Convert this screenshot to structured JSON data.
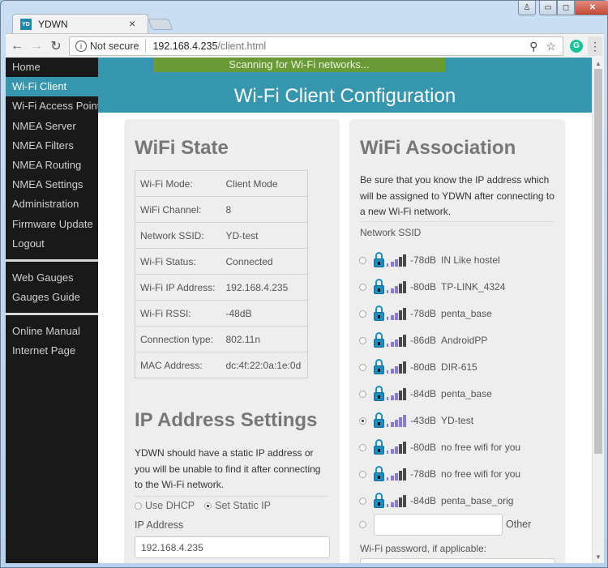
{
  "browser": {
    "tab_title": "YDWN",
    "favicon_text": "YD",
    "tab_close_icon": "×",
    "security_label": "Not secure",
    "url_host": "192.168.4.235",
    "url_path": "/client.html",
    "info_icon": "i",
    "zoom_icon": "⚲",
    "star_icon": "☆",
    "extension_letter": "G",
    "menu_icon": "⋮",
    "back_icon": "←",
    "forward_icon": "→",
    "reload_icon": "↻",
    "window_user_icon": "♙",
    "window_minimize_icon": "▭",
    "window_restore_icon": "◻",
    "window_close_icon": "✕"
  },
  "sidebar": {
    "groups": [
      [
        {
          "label": "Home",
          "active": false
        },
        {
          "label": "Wi-Fi Client",
          "active": true
        },
        {
          "label": "Wi-Fi Access Point",
          "active": false
        },
        {
          "label": "NMEA Server",
          "active": false
        },
        {
          "label": "NMEA Filters",
          "active": false
        },
        {
          "label": "NMEA Routing",
          "active": false
        },
        {
          "label": "NMEA Settings",
          "active": false
        },
        {
          "label": "Administration",
          "active": false
        },
        {
          "label": "Firmware Update",
          "active": false
        },
        {
          "label": "Logout",
          "active": false
        }
      ],
      [
        {
          "label": "Web Gauges",
          "active": false
        },
        {
          "label": "Gauges Guide",
          "active": false
        }
      ],
      [
        {
          "label": "Online Manual",
          "active": false
        },
        {
          "label": "Internet Page",
          "active": false
        }
      ]
    ]
  },
  "header": {
    "status_banner": "Scanning for Wi-Fi networks...",
    "title": "Wi-Fi Client Configuration"
  },
  "wifi_state": {
    "heading": "WiFi State",
    "rows": [
      {
        "label": "Wi-Fi Mode:",
        "value": "Client Mode"
      },
      {
        "label": "WiFi Channel:",
        "value": "8"
      },
      {
        "label": "Network SSID:",
        "value": "YD-test"
      },
      {
        "label": "Wi-Fi Status:",
        "value": "Connected"
      },
      {
        "label": "Wi-Fi IP Address:",
        "value": "192.168.4.235"
      },
      {
        "label": "Wi-Fi RSSI:",
        "value": "-48dB"
      },
      {
        "label": "Connection type:",
        "value": "802.11n"
      },
      {
        "label": "MAC Address:",
        "value": "dc:4f:22:0a:1e:0d"
      }
    ]
  },
  "ip_settings": {
    "heading": "IP Address Settings",
    "description": "YDWN should have a static IP address or you will be unable to find it after connecting to the Wi-Fi network.",
    "mode_options": [
      {
        "label": "Use DHCP",
        "checked": false
      },
      {
        "label": "Set Static IP",
        "checked": true
      }
    ],
    "ip_label": "IP Address",
    "ip_value": "192.168.4.235"
  },
  "association": {
    "heading": "WiFi Association",
    "description": "Be sure that you know the IP address which will be assigned to YDWN after connecting to a new Wi-Fi network.",
    "ssid_label": "Network SSID",
    "networks": [
      {
        "rssi": "-78dB",
        "ssid": "IN Like hostel",
        "selected": false,
        "signal_bars": 3
      },
      {
        "rssi": "-80dB",
        "ssid": "TP-LINK_4324",
        "selected": false,
        "signal_bars": 3
      },
      {
        "rssi": "-78dB",
        "ssid": "penta_base",
        "selected": false,
        "signal_bars": 3
      },
      {
        "rssi": "-86dB",
        "ssid": "AndroidPP",
        "selected": false,
        "signal_bars": 3
      },
      {
        "rssi": "-80dB",
        "ssid": "DIR-615",
        "selected": false,
        "signal_bars": 3
      },
      {
        "rssi": "-84dB",
        "ssid": "penta_base",
        "selected": false,
        "signal_bars": 3
      },
      {
        "rssi": "-43dB",
        "ssid": "YD-test",
        "selected": true,
        "signal_bars": 5
      },
      {
        "rssi": "-80dB",
        "ssid": "no free wifi for you",
        "selected": false,
        "signal_bars": 3
      },
      {
        "rssi": "-78dB",
        "ssid": "no free wifi for you",
        "selected": false,
        "signal_bars": 3
      },
      {
        "rssi": "-84dB",
        "ssid": "penta_base_orig",
        "selected": false,
        "signal_bars": 3
      }
    ],
    "other_label": "Other",
    "other_value": "",
    "password_label": "Wi-Fi password, if applicable:",
    "password_value": ""
  },
  "colors": {
    "accent": "#3596ad",
    "banner": "#6a9a35",
    "sidebar_bg": "#191919",
    "signal_active": "#8a7ad8",
    "signal_inactive": "#4a4a4a",
    "lock": "#1b8fc1"
  }
}
